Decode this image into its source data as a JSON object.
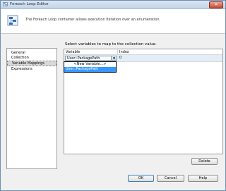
{
  "window": {
    "title": "Foreach Loop Editor",
    "close_glyph": "✕"
  },
  "header": {
    "description": "The Foreach Loop container allows execution iteration over an enumeration."
  },
  "nav": {
    "items": [
      {
        "label": "General"
      },
      {
        "label": "Collection"
      },
      {
        "label": "Variable Mappings"
      },
      {
        "label": "Expressions"
      }
    ],
    "selected_index": 2
  },
  "main": {
    "instruction": "Select variables to map to the collection value.",
    "columns": {
      "variable": "Variable",
      "index": "Index"
    },
    "rows": [
      {
        "variable": "User::PackagePath",
        "index": "0"
      }
    ],
    "dropdown_options": [
      "<New Variable...>",
      "User::PackagePath"
    ],
    "dropdown_selected": 1,
    "delete_label": "Delete"
  },
  "footer": {
    "ok_label": "OK",
    "cancel_label": "Cancel",
    "help_label": "Help"
  },
  "colors": {
    "selection": "#3399ff",
    "row_highlight": "#e3edf8",
    "titlebar": "#c3d4e8"
  },
  "icons": {
    "title": "foreach-loop-icon",
    "header": "foreach-loop-large-icon",
    "close": "close-icon",
    "dropdown": "chevron-down-icon"
  }
}
